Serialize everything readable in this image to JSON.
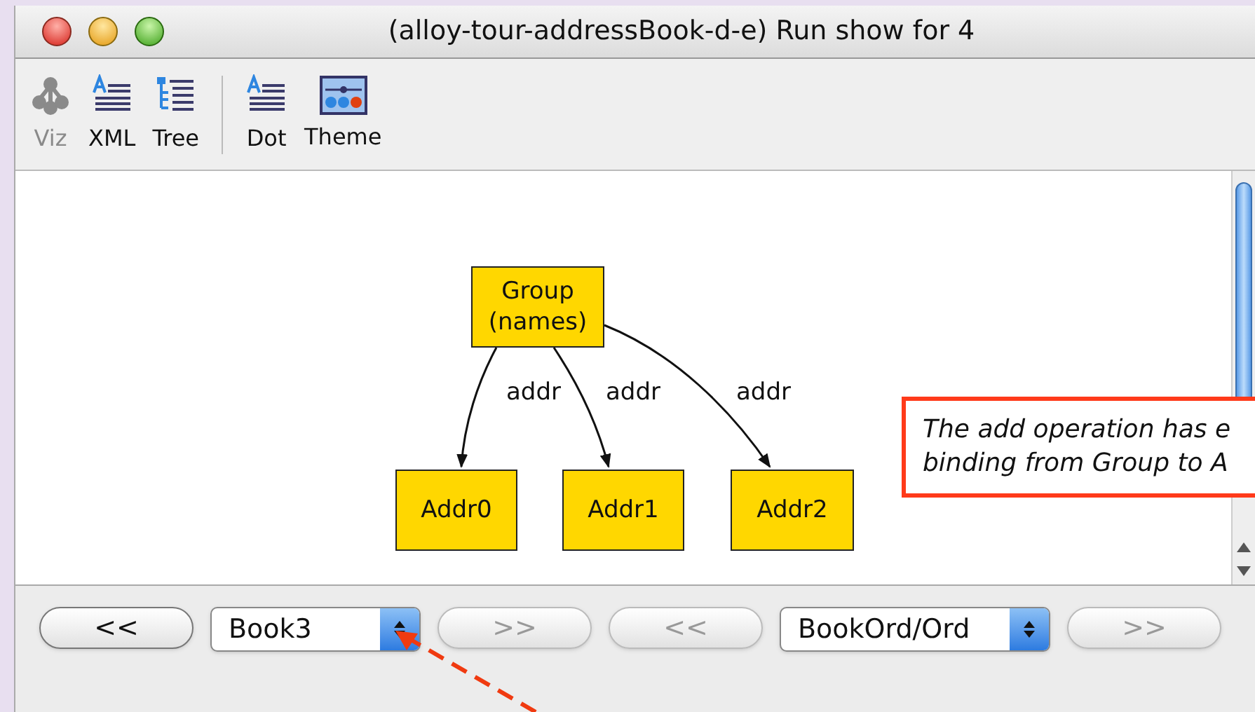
{
  "window": {
    "title": "(alloy-tour-addressBook-d-e) Run show for 4"
  },
  "toolbar": [
    {
      "kind": "viz",
      "label": "Viz",
      "disabled": true
    },
    {
      "kind": "xml",
      "label": "XML",
      "disabled": false
    },
    {
      "kind": "tree",
      "label": "Tree",
      "disabled": false
    },
    {
      "kind": "separator"
    },
    {
      "kind": "dot",
      "label": "Dot",
      "disabled": false
    },
    {
      "kind": "theme",
      "label": "Theme",
      "disabled": false
    }
  ],
  "graph": {
    "nodes": [
      {
        "lines": [
          "Group",
          "(names)"
        ]
      },
      {
        "lines": [
          "Addr0"
        ]
      },
      {
        "lines": [
          "Addr1"
        ]
      },
      {
        "lines": [
          "Addr2"
        ]
      }
    ],
    "edges": [
      {
        "label": "addr"
      },
      {
        "label": "addr"
      },
      {
        "label": "addr"
      }
    ]
  },
  "bottom_bar": [
    {
      "kind": "button",
      "label": "<<",
      "disabled": false
    },
    {
      "kind": "select",
      "value": "Book3"
    },
    {
      "kind": "button",
      "label": ">>",
      "disabled": true
    },
    {
      "kind": "button",
      "label": "<<",
      "disabled": true
    },
    {
      "kind": "select",
      "value": "BookOrd/Ord"
    },
    {
      "kind": "button",
      "label": ">>",
      "disabled": true
    }
  ],
  "callout": {
    "lines": [
      "The add operation has e",
      "binding from Group to A"
    ]
  }
}
